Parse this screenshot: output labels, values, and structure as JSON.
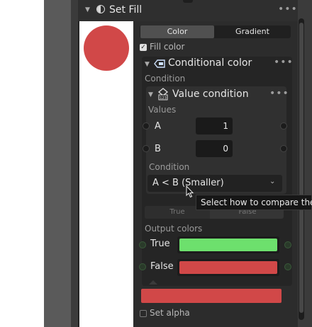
{
  "node": {
    "title": "Set Fill",
    "tabs": {
      "color": "Color",
      "gradient": "Gradient"
    },
    "fill_color_label": "Fill color",
    "set_alpha_label": "Set alpha",
    "fill_swatch_color": "#d14848"
  },
  "conditional": {
    "title": "Conditional color",
    "condition_section": "Condition",
    "value_condition": {
      "title": "Value condition",
      "values_label": "Values",
      "a_label": "A",
      "a_value": "1",
      "b_label": "B",
      "b_value": "0",
      "condition_label": "Condition",
      "condition_selected": "A < B (Smaller)"
    },
    "tooltip": "Select how to compare the",
    "branch_true": "True",
    "branch_false": "False",
    "output_colors_label": "Output colors",
    "out_true_label": "True",
    "out_true_color": "#6de06d",
    "out_false_label": "False",
    "out_false_color": "#d14848"
  },
  "preview_circle_color": "#d14848"
}
